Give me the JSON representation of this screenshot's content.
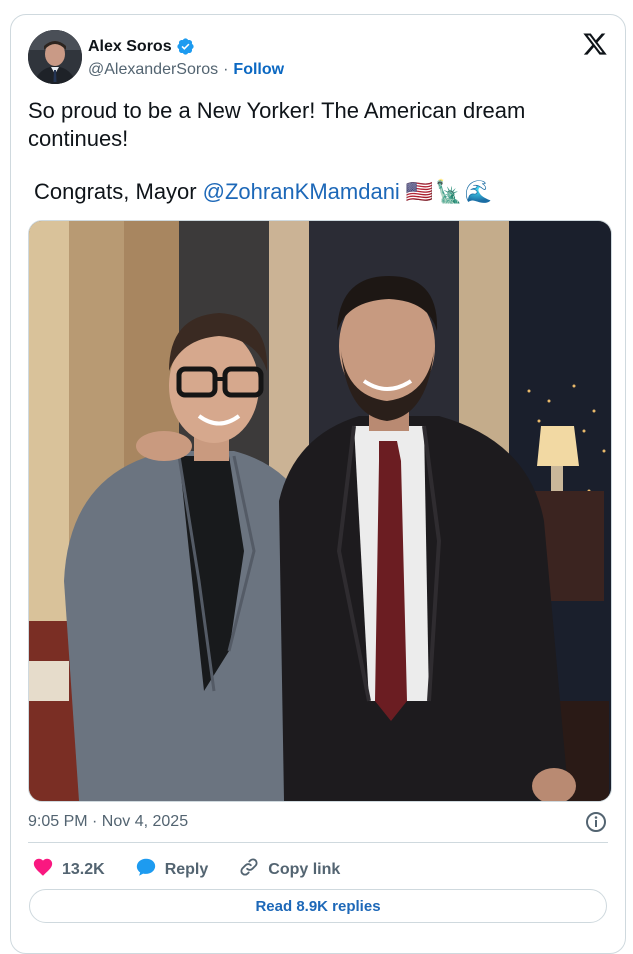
{
  "author": {
    "name": "Alex Soros",
    "handle": "@AlexanderSoros",
    "separator": "·",
    "follow_label": "Follow"
  },
  "tweet": {
    "text_line1": "So proud to be a New Yorker! The American dream continues!",
    "congrats_prefix": "Congrats, Mayor",
    "mention": "@ZohranKMamdani",
    "emojis": [
      "🇺🇸",
      "🗽",
      "🌊"
    ]
  },
  "timestamp": "9:05 PM · Nov 4, 2025",
  "actions": {
    "like_count": "13.2K",
    "reply_label": "Reply",
    "copy_link_label": "Copy link"
  },
  "read_replies_label": "Read 8.9K replies",
  "colors": {
    "like": "#f91880",
    "reply": "#1d9bf0",
    "link_blue": "#1d68b8",
    "verified": "#1d9bf0"
  },
  "icons": [
    "verified-badge-icon",
    "x-logo-icon",
    "info-icon",
    "heart-icon",
    "reply-bubble-icon",
    "link-icon"
  ]
}
